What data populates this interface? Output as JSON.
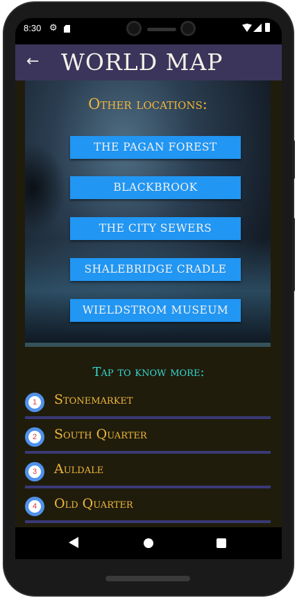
{
  "status_bar": {
    "time": "8:30"
  },
  "app_bar": {
    "back_glyph": "←",
    "title": "WORLD MAP"
  },
  "map_panel": {
    "heading": "Other locations:",
    "buttons": [
      {
        "label": "THE PAGAN FOREST"
      },
      {
        "label": "BLACKBROOK"
      },
      {
        "label": "THE CITY SEWERS"
      },
      {
        "label": "SHALEBRIDGE CRADLE"
      },
      {
        "label": "WIELDSTROM MUSEUM"
      }
    ]
  },
  "list": {
    "heading": "Tap to know more:",
    "items": [
      {
        "number": "1",
        "label": "Stonemarket"
      },
      {
        "number": "2",
        "label": "South Quarter"
      },
      {
        "number": "3",
        "label": "Auldale"
      },
      {
        "number": "4",
        "label": "Old Quarter"
      }
    ]
  },
  "colors": {
    "app_bar": "#3b355c",
    "button": "#2196f3",
    "heading_gold": "#f3b63b",
    "heading_cyan": "#35d8d0",
    "badge_ring": "#5092ea",
    "divider": "#3a3a78"
  },
  "icons": {
    "status": [
      "gear-icon",
      "sd-card-icon",
      "wifi-icon",
      "signal-icon",
      "battery-icon"
    ],
    "nav": [
      "nav-back-icon",
      "nav-home-icon",
      "nav-recents-icon"
    ]
  }
}
